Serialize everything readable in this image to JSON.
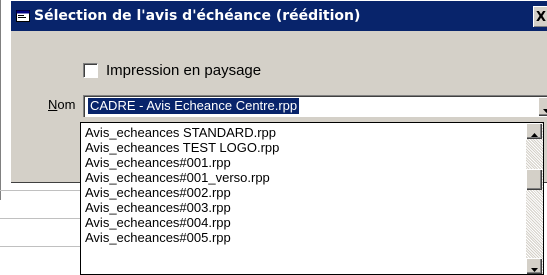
{
  "window": {
    "title": "Sélection de l'avis d'échéance (réédition)",
    "close_label": "X"
  },
  "options": {
    "landscape_label": "Impression en paysage",
    "landscape_checked": false
  },
  "nom": {
    "label_underlined": "N",
    "label_rest": "om",
    "selected_value": "CADRE - Avis Echeance Centre.rpp"
  },
  "dropdown": {
    "items": [
      "Avis_echeances STANDARD.rpp",
      "Avis_echeances TEST LOGO.rpp",
      "Avis_echeances#001.rpp",
      "Avis_echeances#001_verso.rpp",
      "Avis_echeances#002.rpp",
      "Avis_echeances#003.rpp",
      "Avis_echeances#004.rpp",
      "Avis_echeances#005.rpp"
    ]
  },
  "icons": {
    "window": "app-window-icon",
    "combo_arrow": "chevron-down-icon",
    "scroll_up": "scroll-up-icon",
    "scroll_down": "scroll-down-icon"
  },
  "colors": {
    "titlebar": "#08246b",
    "selection": "#08246b",
    "face": "#d4d0c8"
  }
}
